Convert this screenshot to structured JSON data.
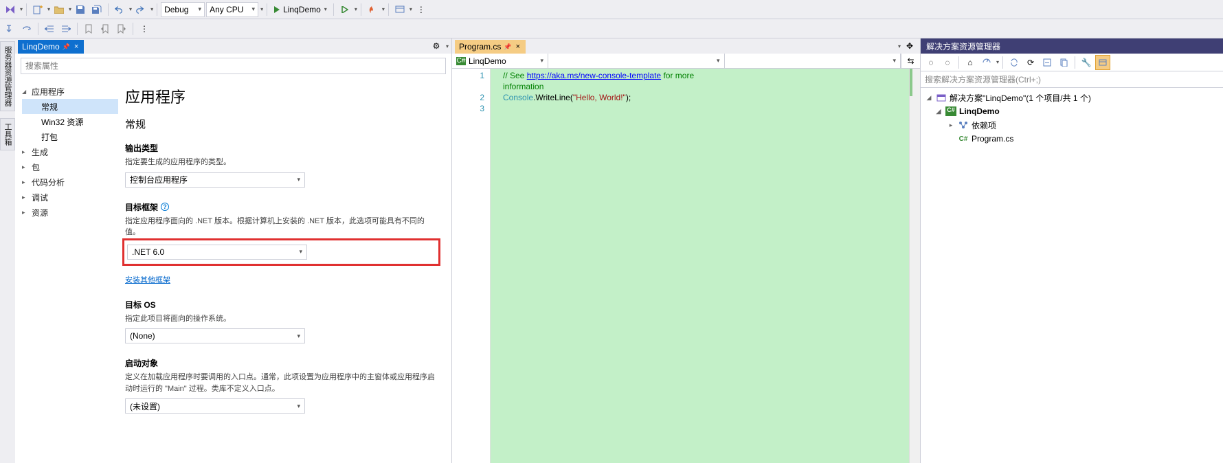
{
  "toolbar": {
    "config": "Debug",
    "platform": "Any CPU",
    "start_target": "LinqDemo"
  },
  "vertical_tabs": [
    "服务器资源管理器",
    "工具箱"
  ],
  "properties_tab": {
    "title": "LinqDemo",
    "search_placeholder": "搜索属性",
    "nav": [
      {
        "label": "应用程序",
        "expanded": true,
        "children": [
          "常规",
          "Win32 资源",
          "打包"
        ]
      },
      {
        "label": "生成"
      },
      {
        "label": "包"
      },
      {
        "label": "代码分析"
      },
      {
        "label": "调试"
      },
      {
        "label": "资源"
      }
    ],
    "selected_sub": "常规",
    "heading": "应用程序",
    "section": "常规",
    "fields": {
      "output_type": {
        "title": "输出类型",
        "desc": "指定要生成的应用程序的类型。",
        "value": "控制台应用程序"
      },
      "target_framework": {
        "title": "目标框架",
        "desc": "指定应用程序面向的 .NET 版本。根据计算机上安装的 .NET 版本，此选项可能具有不同的值。",
        "value": ".NET 6.0",
        "link": "安装其他框架"
      },
      "target_os": {
        "title": "目标 OS",
        "desc": "指定此项目将面向的操作系统。",
        "value": "(None)"
      },
      "startup_object": {
        "title": "启动对象",
        "desc": "定义在加载应用程序时要调用的入口点。通常，此项设置为应用程序中的主窗体或应用程序启动时运行的 \"Main\" 过程。类库不定义入口点。",
        "value": "(未设置)"
      }
    }
  },
  "code_tab": {
    "title": "Program.cs",
    "nav_project": "LinqDemo",
    "lines": [
      {
        "n": 1,
        "pre": "// See ",
        "link": "https://aka.ms/new-console-template",
        "post": " for more"
      },
      {
        "n": "",
        "plain_comment": "information"
      },
      {
        "n": 2,
        "code_type": "Console",
        "code_method": ".WriteLine(",
        "code_str": "\"Hello, World!\"",
        "code_end": ");"
      },
      {
        "n": 3
      }
    ]
  },
  "solution_explorer": {
    "title": "解决方案资源管理器",
    "search_placeholder": "搜索解决方案资源管理器(Ctrl+;)",
    "root": "解决方案\"LinqDemo\"(1 个项目/共 1 个)",
    "project": "LinqDemo",
    "deps": "依赖项",
    "file": "Program.cs"
  }
}
